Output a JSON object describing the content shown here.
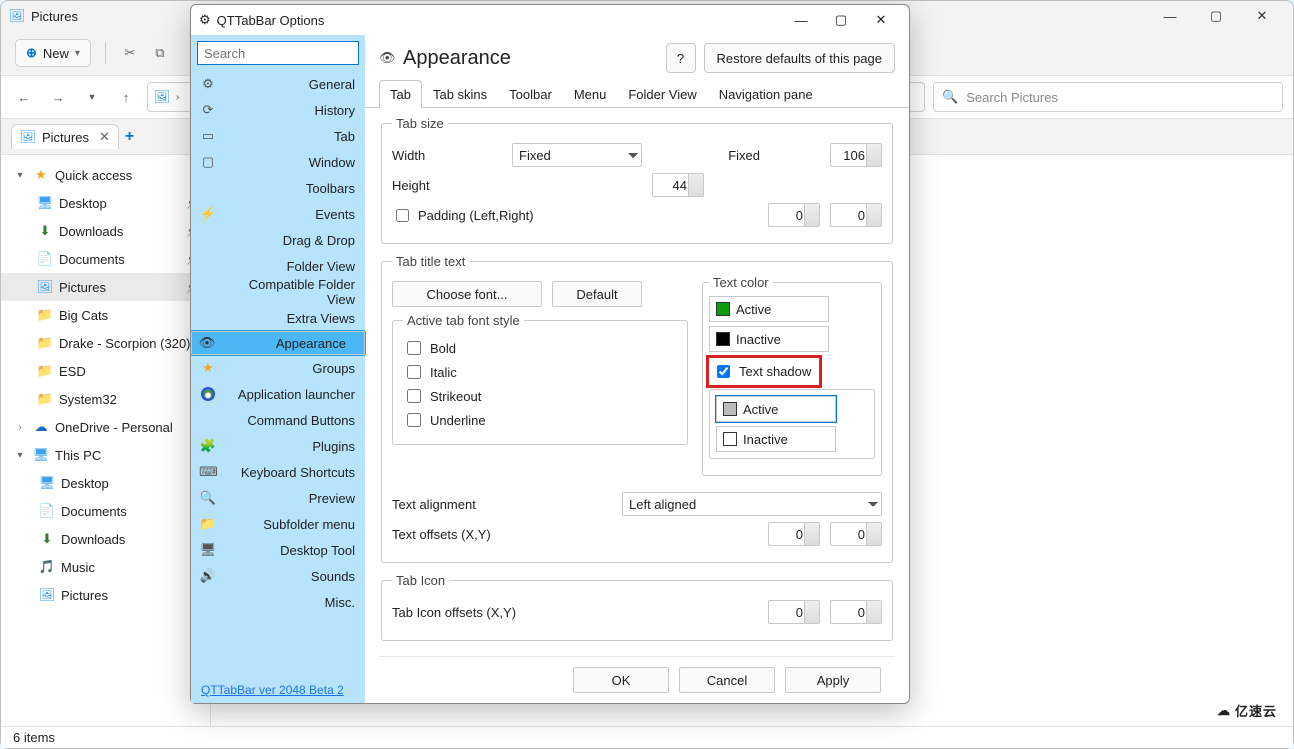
{
  "parent_window": {
    "title": "Pictures",
    "new_button": "New",
    "search_placeholder": "Search Pictures",
    "tab_label": "Pictures",
    "status": "6 items"
  },
  "tree": {
    "quick_access": "Quick access",
    "items_qa": [
      {
        "icon": "monitor",
        "label": "Desktop",
        "pin": true
      },
      {
        "icon": "dl",
        "label": "Downloads",
        "pin": true
      },
      {
        "icon": "doc",
        "label": "Documents",
        "pin": true
      },
      {
        "icon": "pic",
        "label": "Pictures",
        "pin": true,
        "selected": true
      },
      {
        "icon": "folder",
        "label": "Big Cats"
      },
      {
        "icon": "folder",
        "label": "Drake - Scorpion (320)"
      },
      {
        "icon": "folder",
        "label": "ESD"
      },
      {
        "icon": "folder",
        "label": "System32"
      }
    ],
    "onedrive": "OneDrive - Personal",
    "this_pc": "This PC",
    "items_pc": [
      {
        "icon": "monitor",
        "label": "Desktop"
      },
      {
        "icon": "doc",
        "label": "Documents"
      },
      {
        "icon": "dl",
        "label": "Downloads"
      },
      {
        "icon": "music",
        "label": "Music"
      },
      {
        "icon": "pic",
        "label": "Pictures"
      }
    ]
  },
  "dialog": {
    "title": "QTTabBar Options",
    "search_placeholder": "Search",
    "categories": [
      {
        "ic": "⚙",
        "name": "General"
      },
      {
        "ic": "⟳",
        "name": "History"
      },
      {
        "ic": "▭",
        "name": "Tab"
      },
      {
        "ic": "▢",
        "name": "Window"
      },
      {
        "ic": "",
        "name": "Toolbars"
      },
      {
        "ic": "⚡",
        "name": "Events",
        "cls": "bolt"
      },
      {
        "ic": "",
        "name": "Drag & Drop"
      },
      {
        "ic": "",
        "name": "Folder View"
      },
      {
        "ic": "",
        "name": "Compatible Folder View"
      },
      {
        "ic": "",
        "name": "Extra Views"
      },
      {
        "ic": "👁",
        "name": "Appearance",
        "sel": true,
        "cls": "eye"
      },
      {
        "ic": "★",
        "name": "Groups",
        "cls": "star"
      },
      {
        "ic": "●",
        "name": "Application launcher",
        "cls": "pal"
      },
      {
        "ic": "",
        "name": "Command Buttons"
      },
      {
        "ic": "🧩",
        "name": "Plugins"
      },
      {
        "ic": "⌨",
        "name": "Keyboard Shortcuts"
      },
      {
        "ic": "🔍",
        "name": "Preview"
      },
      {
        "ic": "📁",
        "name": "Subfolder menu"
      },
      {
        "ic": "🖥",
        "name": "Desktop Tool"
      },
      {
        "ic": "🔊",
        "name": "Sounds"
      },
      {
        "ic": "",
        "name": "Misc."
      }
    ],
    "version": "QTTabBar ver 2048 Beta 2",
    "page_title": "Appearance",
    "help_hint": "?",
    "restore": "Restore defaults of this page",
    "subtabs": [
      "Tab",
      "Tab skins",
      "Toolbar",
      "Menu",
      "Folder View",
      "Navigation pane"
    ],
    "tabsize": {
      "legend": "Tab size",
      "width_label": "Width",
      "width_mode": "Fixed",
      "width_val_label": "Fixed",
      "width_val": "106",
      "height_label": "Height",
      "height_val": "44",
      "padding_label": "Padding (Left,Right)",
      "pad_l": "0",
      "pad_r": "0"
    },
    "tabtitle": {
      "legend": "Tab title text",
      "choose_font": "Choose font...",
      "default": "Default",
      "active_style_legend": "Active tab font style",
      "styles": [
        "Bold",
        "Italic",
        "Strikeout",
        "Underline"
      ],
      "textcolor_legend": "Text color",
      "active": "Active",
      "inactive": "Inactive",
      "shadow": "Text shadow",
      "shadow_active": "Active",
      "shadow_inactive": "Inactive",
      "align_label": "Text alignment",
      "align_val": "Left aligned",
      "offsets_label": "Text offsets (X,Y)",
      "ox": "0",
      "oy": "0"
    },
    "tabicon": {
      "legend": "Tab Icon",
      "offsets_label": "Tab Icon offsets (X,Y)",
      "ox": "0",
      "oy": "0"
    },
    "actions": {
      "ok": "OK",
      "cancel": "Cancel",
      "apply": "Apply"
    }
  },
  "watermark": "亿速云"
}
